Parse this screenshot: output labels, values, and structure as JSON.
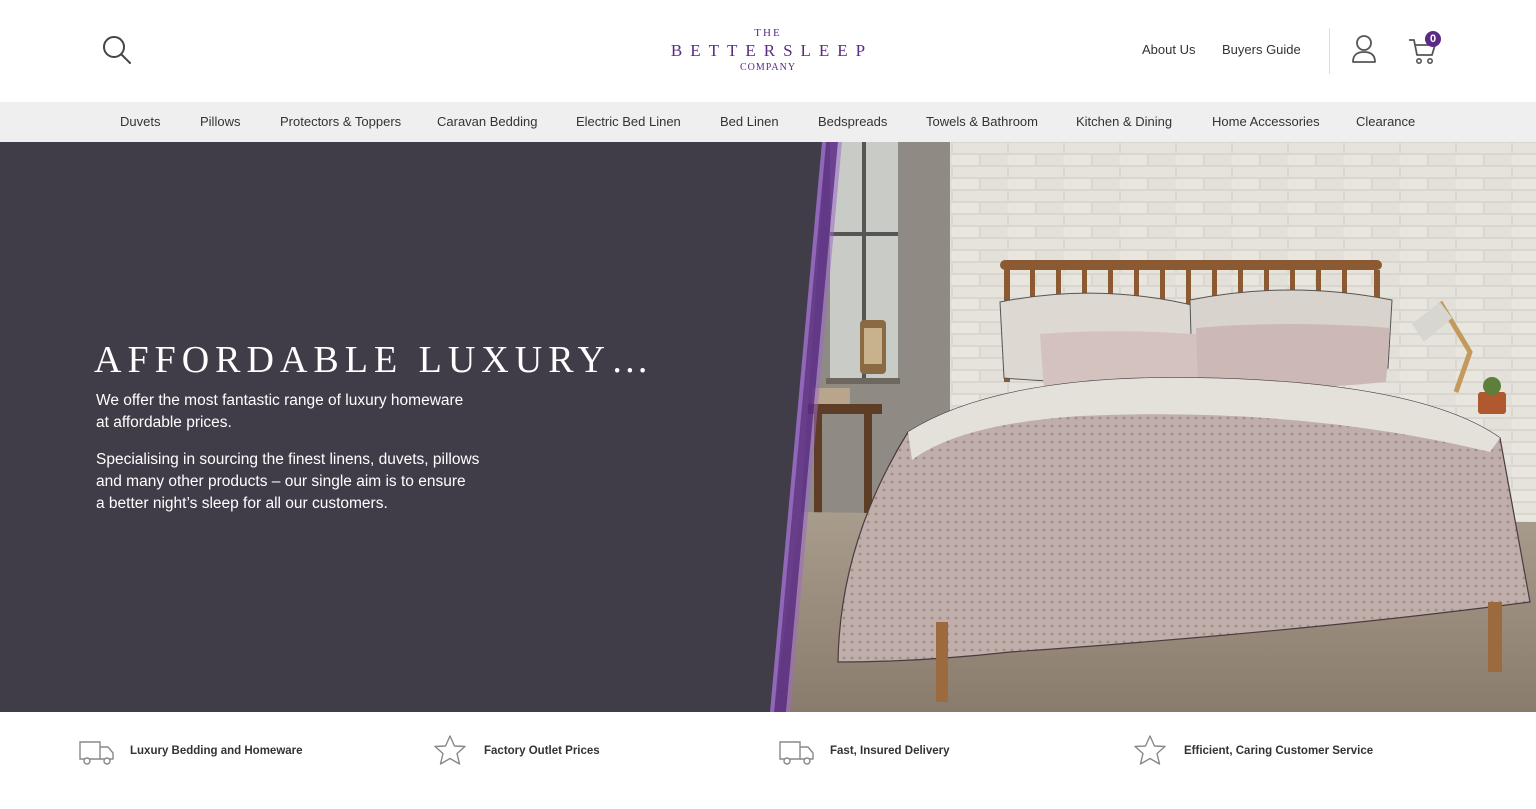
{
  "header": {
    "logo": {
      "the": "THE",
      "brand": "BETTERSLEEP",
      "company": "COMPANY"
    },
    "links": {
      "about": "About Us",
      "buyers_guide": "Buyers Guide"
    },
    "cart_count": "0",
    "icons": {
      "search": "search-icon",
      "account": "user-icon",
      "cart": "cart-icon"
    },
    "brand_color": "#5b2a86"
  },
  "nav": {
    "items": [
      "Duvets",
      "Pillows",
      "Protectors & Toppers",
      "Caravan Bedding",
      "Electric Bed Linen",
      "Bed Linen",
      "Bedspreads",
      "Towels & Bathroom",
      "Kitchen & Dining",
      "Home Accessories",
      "Clearance"
    ]
  },
  "hero": {
    "title": "AFFORDABLE LUXURY…",
    "p1_line1": "We offer the most fantastic range of luxury homeware",
    "p1_line2": "at affordable prices.",
    "p2_line1": "Specialising in sourcing the finest linens, duvets, pillows",
    "p2_line2": "and many other products –  our single aim is to ensure",
    "p2_line3": "a better night’s sleep for all our customers.",
    "background_color": "#403d48",
    "accent_color": "#7b4fa8"
  },
  "features": [
    {
      "icon": "truck-icon",
      "label": "Luxury Bedding and Homeware"
    },
    {
      "icon": "star-icon",
      "label": "Factory Outlet Prices"
    },
    {
      "icon": "truck-icon",
      "label": "Fast, Insured Delivery"
    },
    {
      "icon": "star-icon",
      "label": "Efficient, Caring Customer Service"
    }
  ]
}
